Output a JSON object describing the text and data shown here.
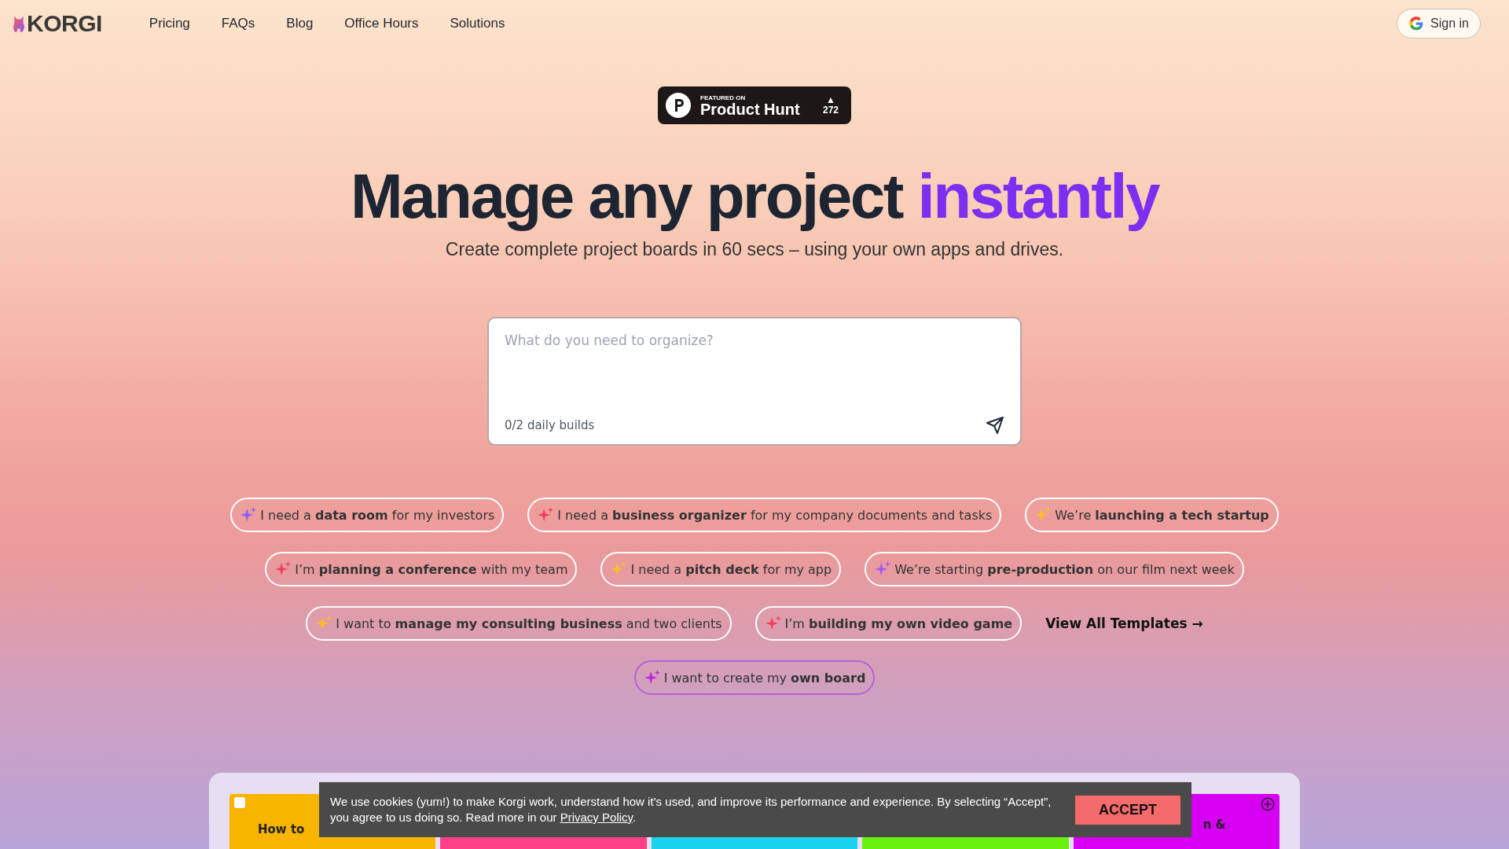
{
  "nav": {
    "logo": "KORGI",
    "links": [
      "Pricing",
      "FAQs",
      "Blog",
      "Office Hours",
      "Solutions"
    ],
    "sign_in": "Sign in"
  },
  "badge": {
    "overline": "FEATURED ON",
    "name": "Product Hunt",
    "arrow": "▲",
    "votes": "272"
  },
  "hero": {
    "title": "Manage any project",
    "highlight": "instantly",
    "subtitle": "Create complete project boards in 60 secs – using your own apps and drives."
  },
  "prompt": {
    "placeholder": "What do you need to organize?",
    "counter": "0/2 daily builds"
  },
  "suggestions": [
    [
      {
        "kind": "prompt",
        "color": "#8b5cf6",
        "text": "I need a **data room** for my investors"
      },
      {
        "kind": "prompt",
        "color": "#f43f5e",
        "text": "I need a **business organizer** for my company documents and tasks"
      },
      {
        "kind": "prompt",
        "color": "#fbbf24",
        "text": "We’re **launching a tech startup**"
      }
    ],
    [
      {
        "kind": "prompt",
        "color": "#f43f5e",
        "text": "I’m **planning a conference** with my team"
      },
      {
        "kind": "prompt",
        "color": "#fbbf24",
        "text": "I need a **pitch deck** for my app"
      },
      {
        "kind": "prompt",
        "color": "#a855f7",
        "text": "We’re starting **pre-production** on our film next week"
      }
    ],
    [
      {
        "kind": "prompt",
        "color": "#fbbf24",
        "text": "I want to **manage my consulting business** and two clients"
      },
      {
        "kind": "prompt",
        "color": "#f43f5e",
        "text": "I’m **building my own video game**"
      },
      {
        "kind": "link",
        "text": "View All Templates",
        "arrow": "→"
      }
    ],
    [
      {
        "kind": "custom",
        "color": "#c026d3",
        "text": "I want to create my **own board**"
      }
    ]
  ],
  "board": {
    "columns": [
      {
        "color": "#f7b500",
        "title": "How to"
      },
      {
        "color": "#ff3f86"
      },
      {
        "color": "#19d3ee"
      },
      {
        "color": "#69f00f"
      },
      {
        "color": "#d600f2",
        "title": "n &"
      }
    ]
  },
  "cookie": {
    "text": "We use cookies (yum!) to make Korgi work, understand how it’s used, and improve its performance and experience. By selecting “Accept”, you agree to us doing so. Read more in our",
    "link": "Privacy Policy",
    "end": ".",
    "button": "ACCEPT"
  }
}
